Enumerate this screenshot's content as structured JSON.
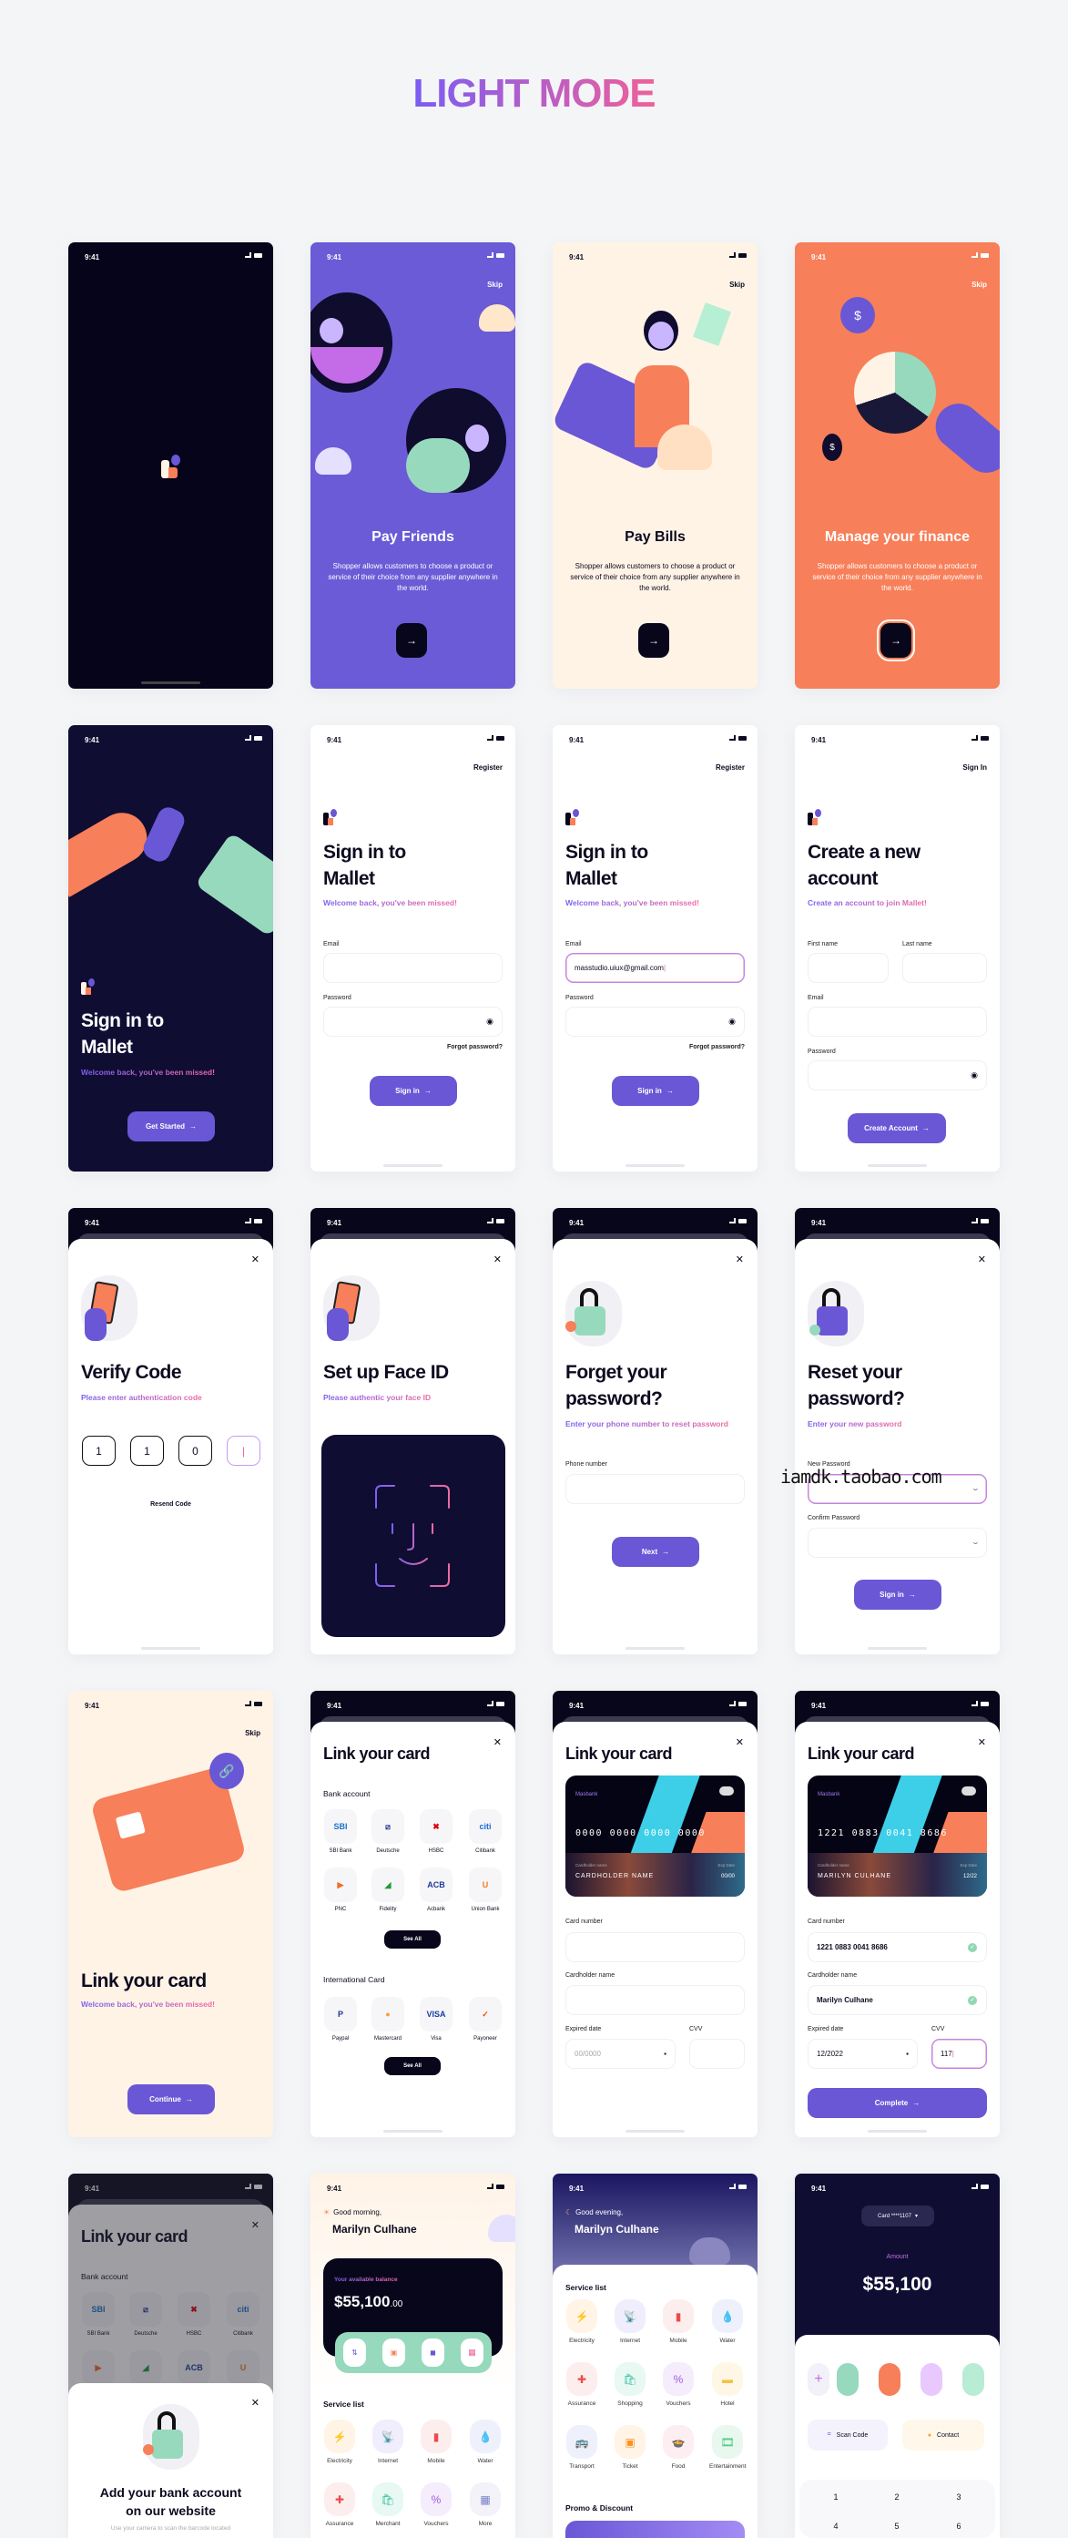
{
  "header": {
    "title": "LIGHT MODE"
  },
  "status": {
    "time": "9:41"
  },
  "colors": {
    "primary": "#6957d6",
    "dark": "#07061a",
    "navy": "#100d33",
    "orange": "#f77f59",
    "peach": "#fff3e6",
    "mint": "#97d9bd"
  },
  "onboarding": {
    "skip": "Skip",
    "description": "Shopper allows customers to choose a product or service of their choice from any supplier anywhere in the world.",
    "slides": [
      {
        "title": "Pay Friends"
      },
      {
        "title": "Pay Bills"
      },
      {
        "title": "Manage your finance"
      }
    ],
    "next_icon": "arrow-right-icon"
  },
  "welcome": {
    "title_1": "Sign in to",
    "title_2": "Mallet",
    "subtitle": "Welcome back, you've been missed!",
    "button": "Get Started"
  },
  "signin": {
    "top_link": "Register",
    "title_1": "Sign in to",
    "title_2": "Mallet",
    "subtitle": "Welcome back, you've been missed!",
    "email_label": "Email",
    "password_label": "Password",
    "forgot": "Forgot password?",
    "button": "Sign in",
    "email_value": "masstudio.uiux@gmail.com"
  },
  "register": {
    "top_link": "Sign In",
    "title_1": "Create a new",
    "title_2": "account",
    "subtitle": "Create an account to join Mallet!",
    "first_name": "First name",
    "last_name": "Last name",
    "email_label": "Email",
    "password_label": "Password",
    "button": "Create Account"
  },
  "verify": {
    "title": "Verify Code",
    "subtitle": "Please enter authentication code",
    "digits": [
      "1",
      "1",
      "0",
      "|"
    ],
    "resend": "Resend Code"
  },
  "faceid": {
    "title": "Set up Face ID",
    "subtitle": "Please authentic your face ID"
  },
  "forgot": {
    "title_1": "Forget your",
    "title_2": "password?",
    "subtitle": "Enter your phone number to reset password",
    "phone_label": "Phone number",
    "button": "Next"
  },
  "reset": {
    "title_1": "Reset your",
    "title_2": "password?",
    "subtitle": "Enter your new password",
    "new_label": "New Password",
    "confirm_label": "Confirm Password",
    "button": "Sign in"
  },
  "watermark": "iamdk.taobao.com",
  "linkintro": {
    "skip": "Skip",
    "title": "Link your card",
    "subtitle": "Welcome back, you've been missed!",
    "button": "Continue"
  },
  "linkcard": {
    "title": "Link your card",
    "bank_section": "Bank account",
    "intl_section": "International Card",
    "see_all": "See All",
    "banks": [
      {
        "logo": "SBI",
        "label": "SBI Bank",
        "color": "#1a73c8"
      },
      {
        "logo": "⧄",
        "label": "Deutsche",
        "color": "#1d2c8a"
      },
      {
        "logo": "✖",
        "label": "HSBC",
        "color": "#db0011"
      },
      {
        "logo": "citi",
        "label": "Citibank",
        "color": "#1d6bd6"
      },
      {
        "logo": "▶",
        "label": "PNC",
        "color": "#f26b21"
      },
      {
        "logo": "◢",
        "label": "Fidelity",
        "color": "#1e9a3a"
      },
      {
        "logo": "ACB",
        "label": "Acbank",
        "color": "#1d3b9a"
      },
      {
        "logo": "U",
        "label": "Union Bank",
        "color": "#f47a20"
      }
    ],
    "intl": [
      {
        "logo": "P",
        "label": "Paypal",
        "color": "#1b3a8c"
      },
      {
        "logo": "●",
        "label": "Mastercard",
        "color": "#f59d3b"
      },
      {
        "logo": "VISA",
        "label": "Visa",
        "color": "#1a3ba6"
      },
      {
        "logo": "✓",
        "label": "Payoneer",
        "color": "#ff4800"
      }
    ]
  },
  "cardform": {
    "title": "Link your card",
    "bank": "Masbank",
    "holder_caption": "Cardholder name",
    "exp_caption": "Exp Date",
    "card_number_label": "Card number",
    "holder_label": "Cardholder name",
    "exp_label": "Expired date",
    "cvv_label": "CVV",
    "empty": {
      "number": "0000 0000 0000 0000",
      "holder": "CARDHOLDER NAME",
      "exp": "00/00",
      "exp_placeholder": "00/0000"
    },
    "filled": {
      "number": "1221 0883 0041 8686",
      "holder": "MARILYN CULHANE",
      "exp": "12/22",
      "number_input": "1221 0883 0041 8686",
      "holder_input": "Marilyn Culhane",
      "exp_input": "12/2022",
      "cvv_input": "117"
    },
    "button": "Complete"
  },
  "addbank": {
    "title": "Link your card",
    "bank_section": "Bank account",
    "sheet_title_1": "Add your bank account",
    "sheet_title_2": "on our website",
    "sheet_text": "Use your camera to scan the barcode located"
  },
  "home_morning": {
    "greeting": "Good morning,",
    "name": "Marilyn Culhane",
    "balance_label": "Your available balance",
    "balance": "$55,100",
    "balance_cents": ".00",
    "section": "Service list",
    "services": [
      {
        "label": "Electricity",
        "icon": "⚡",
        "bg": "#fff4e6",
        "fg": "#f7931e"
      },
      {
        "label": "Internet",
        "icon": "📡",
        "bg": "#f0eefc",
        "fg": "#6957d6"
      },
      {
        "label": "Mobile",
        "icon": "▮",
        "bg": "#fdeeee",
        "fg": "#ef4a4a"
      },
      {
        "label": "Water",
        "icon": "💧",
        "bg": "#eef1fc",
        "fg": "#5a6ee0"
      },
      {
        "label": "Assurance",
        "icon": "✚",
        "bg": "#fdeeee",
        "fg": "#ef4a4a"
      },
      {
        "label": "Merchant",
        "icon": "🛍",
        "bg": "#e8f8f3",
        "fg": "#3ec4a0"
      },
      {
        "label": "Vouchers",
        "icon": "%",
        "bg": "#f5ecfc",
        "fg": "#a25be0"
      },
      {
        "label": "More",
        "icon": "▦",
        "bg": "#f2f2f8",
        "fg": "#7880c8"
      }
    ]
  },
  "home_evening": {
    "greeting": "Good evening,",
    "name": "Marilyn Culhane",
    "section": "Service list",
    "promo": "Promo & Discount",
    "services": [
      {
        "label": "Electricity",
        "icon": "⚡",
        "bg": "#fff4e6",
        "fg": "#f7931e"
      },
      {
        "label": "Internet",
        "icon": "📡",
        "bg": "#f0eefc",
        "fg": "#6957d6"
      },
      {
        "label": "Mobile",
        "icon": "▮",
        "bg": "#fdeeee",
        "fg": "#ef4a4a"
      },
      {
        "label": "Water",
        "icon": "💧",
        "bg": "#eef1fc",
        "fg": "#5a6ee0"
      },
      {
        "label": "Assurance",
        "icon": "✚",
        "bg": "#fdeeee",
        "fg": "#ef4a4a"
      },
      {
        "label": "Shopping",
        "icon": "🛍",
        "bg": "#e8f8f3",
        "fg": "#3ec4a0"
      },
      {
        "label": "Vouchers",
        "icon": "%",
        "bg": "#f5ecfc",
        "fg": "#a25be0"
      },
      {
        "label": "Hotel",
        "icon": "▬",
        "bg": "#fff7e6",
        "fg": "#f5c242"
      },
      {
        "label": "Transport",
        "icon": "🚌",
        "bg": "#eef1fc",
        "fg": "#5a6ee0"
      },
      {
        "label": "Ticket",
        "icon": "▣",
        "bg": "#fff4e6",
        "fg": "#f7931e"
      },
      {
        "label": "Food",
        "icon": "🍲",
        "bg": "#fdeef2",
        "fg": "#ef4a6a"
      },
      {
        "label": "Entertainment",
        "icon": "🎞",
        "bg": "#e8f8ee",
        "fg": "#3ec47a"
      }
    ]
  },
  "transfer": {
    "card_select": "Card ****1107",
    "amount_label": "Amount",
    "amount": "$55,100",
    "scan": "Scan Code",
    "contact": "Contact",
    "keys": [
      "1",
      "2",
      "3",
      "4",
      "5",
      "6"
    ]
  }
}
